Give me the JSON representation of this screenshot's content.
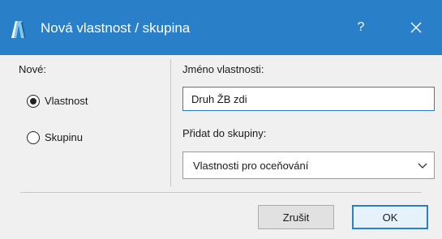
{
  "window": {
    "title": "Nová vlastnost / skupina",
    "help_label": "?",
    "titlebar_color": "#2a7fc9"
  },
  "left_panel": {
    "heading": "Nové:",
    "options": [
      {
        "label": "Vlastnost",
        "selected": true
      },
      {
        "label": "Skupinu",
        "selected": false
      }
    ]
  },
  "right_panel": {
    "name_label": "Jméno vlastnosti:",
    "name_value": "Druh ŽB zdi",
    "group_label": "Přidat do skupiny:",
    "group_selected": "Vlastnosti pro oceňování"
  },
  "buttons": {
    "cancel_label": "Zrušit",
    "ok_label": "OK"
  }
}
